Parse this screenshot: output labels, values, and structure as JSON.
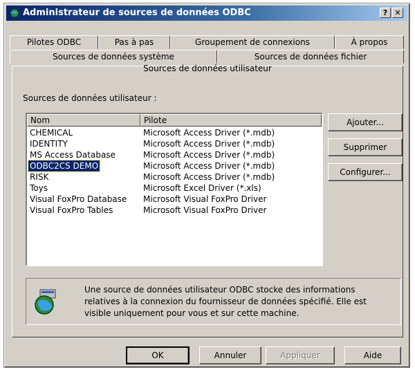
{
  "window": {
    "title": "Administrateur de sources de données ODBC",
    "help_label": "?",
    "close_label": "✕"
  },
  "tabs": {
    "row1": [
      "Pilotes ODBC",
      "Pas à pas",
      "Groupement de connexions",
      "À propos"
    ],
    "row2": [
      "Sources de données système",
      "Sources de données fichier"
    ],
    "active": "Sources de données utilisateur"
  },
  "section_label": "Sources de données utilisateur :",
  "list": {
    "columns": [
      "Nom",
      "Pilote"
    ],
    "rows": [
      {
        "name": "CHEMICAL",
        "driver": "Microsoft Access Driver (*.mdb)"
      },
      {
        "name": "IDENTITY",
        "driver": "Microsoft Access Driver (*.mdb)"
      },
      {
        "name": "MS Access Database",
        "driver": "Microsoft Access Driver (*.mdb)"
      },
      {
        "name": "ODBC2CS DEMO",
        "driver": "Microsoft Access Driver (*.mdb)"
      },
      {
        "name": "RISK",
        "driver": "Microsoft Access Driver (*.mdb)"
      },
      {
        "name": "Toys",
        "driver": "Microsoft Excel Driver (*.xls)"
      },
      {
        "name": "Visual FoxPro Database",
        "driver": "Microsoft Visual FoxPro Driver"
      },
      {
        "name": "Visual FoxPro Tables",
        "driver": "Microsoft Visual FoxPro Driver"
      }
    ],
    "selected_index": 3
  },
  "side_buttons": {
    "add": "Ajouter...",
    "remove": "Supprimer",
    "configure": "Configurer..."
  },
  "info_text": "Une source de données utilisateur ODBC stocke des informations relatives à la connexion du fournisseur de données spécifié. Elle est visible uniquement pour vous et sur cette machine.",
  "bottom_buttons": {
    "ok": "OK",
    "cancel": "Annuler",
    "apply": "Appliquer",
    "help": "Aide"
  },
  "icons": {
    "app": "odbc-admin-icon",
    "info": "globe-datasource-icon"
  }
}
